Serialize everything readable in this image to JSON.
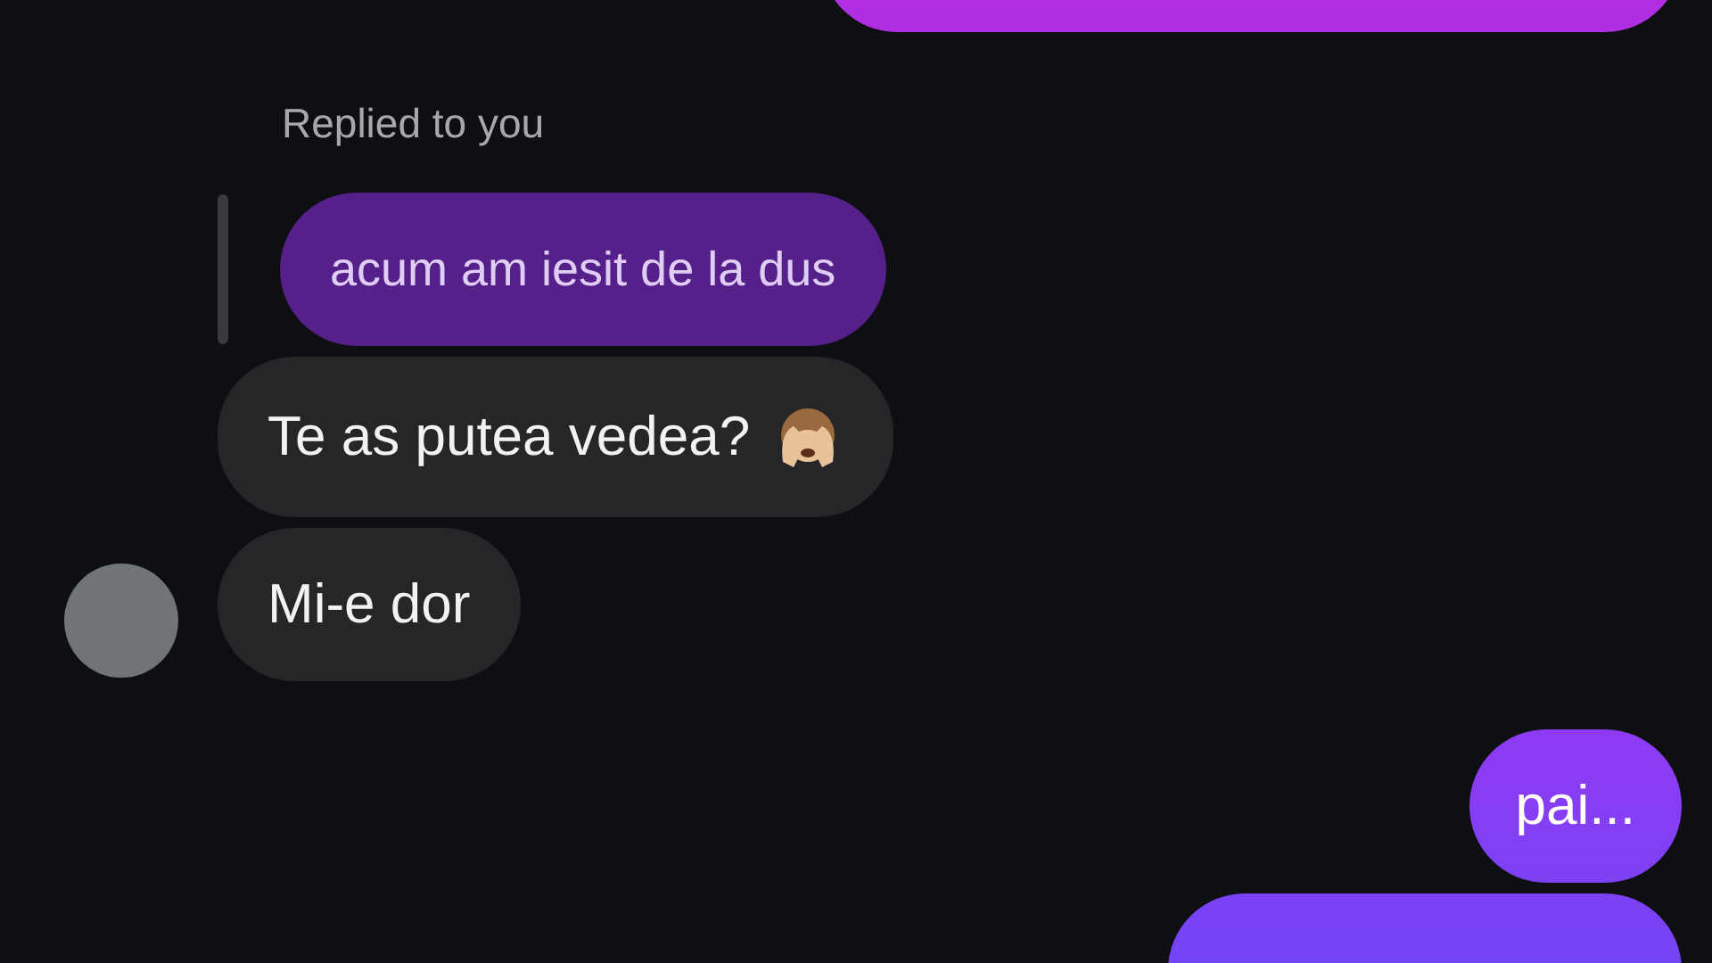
{
  "messages": [
    {
      "kind": "sent"
    },
    {
      "kind": "reply_label",
      "text": "Replied to you"
    },
    {
      "kind": "quoted",
      "text": "acum am iesit de la dus"
    },
    {
      "kind": "received",
      "text": "Te as putea vedea?",
      "emoji": true
    },
    {
      "kind": "received",
      "text": "Mi-e dor",
      "avatar": true
    },
    {
      "kind": "sent",
      "text": "pai..."
    },
    {
      "kind": "sent"
    }
  ]
}
